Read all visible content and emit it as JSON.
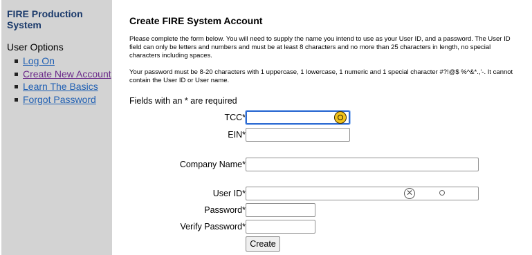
{
  "sidebar": {
    "brand": "FIRE Production System",
    "options_heading": "User Options",
    "items": [
      {
        "label": "Log On"
      },
      {
        "label": "Create New Account"
      },
      {
        "label": "Learn The Basics"
      },
      {
        "label": "Forgot Password"
      }
    ]
  },
  "main": {
    "title": "Create FIRE System Account",
    "intro": "Please complete the form below. You will need to supply the name you intend to use as your User ID, and a password. The User ID field can only be letters and numbers and must be at least 8 characters and no more than 25 characters in length, no special characters including spaces.",
    "password_note": "Your password must be 8-20 characters with 1 uppercase, 1 lowercase, 1 numeric and 1 special character #?!@$ %^&*.,'-. It cannot contain the User ID or User name.",
    "required_note": "Fields with an * are required"
  },
  "form": {
    "tcc_label": "TCC*",
    "ein_label": "EIN*",
    "company_label": "Company Name*",
    "userid_label": "User ID*",
    "password_label": "Password*",
    "verify_label": "Verify Password*",
    "create_label": "Create"
  }
}
